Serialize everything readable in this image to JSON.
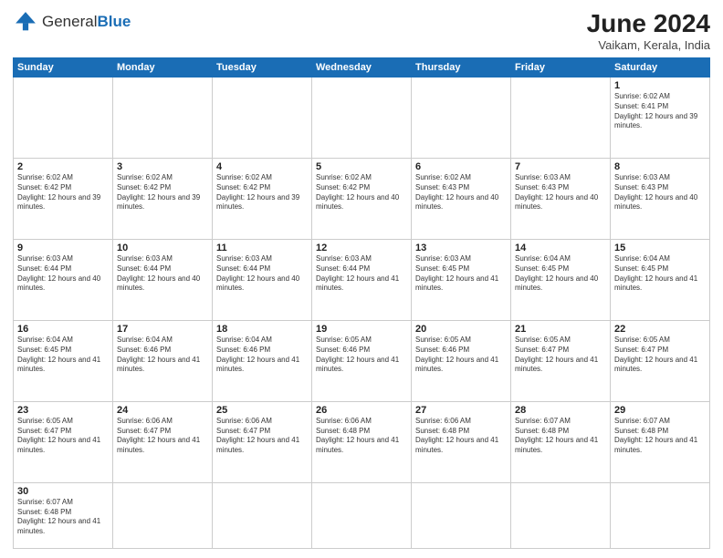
{
  "header": {
    "logo_general": "General",
    "logo_blue": "Blue",
    "title": "June 2024",
    "subtitle": "Vaikam, Kerala, India"
  },
  "weekdays": [
    "Sunday",
    "Monday",
    "Tuesday",
    "Wednesday",
    "Thursday",
    "Friday",
    "Saturday"
  ],
  "weeks": [
    [
      {
        "day": "",
        "sunrise": "",
        "sunset": "",
        "daylight": ""
      },
      {
        "day": "",
        "sunrise": "",
        "sunset": "",
        "daylight": ""
      },
      {
        "day": "",
        "sunrise": "",
        "sunset": "",
        "daylight": ""
      },
      {
        "day": "",
        "sunrise": "",
        "sunset": "",
        "daylight": ""
      },
      {
        "day": "",
        "sunrise": "",
        "sunset": "",
        "daylight": ""
      },
      {
        "day": "",
        "sunrise": "",
        "sunset": "",
        "daylight": ""
      },
      {
        "day": "1",
        "sunrise": "6:02 AM",
        "sunset": "6:41 PM",
        "daylight": "12 hours and 39 minutes."
      }
    ],
    [
      {
        "day": "2",
        "sunrise": "6:02 AM",
        "sunset": "6:42 PM",
        "daylight": "12 hours and 39 minutes."
      },
      {
        "day": "3",
        "sunrise": "6:02 AM",
        "sunset": "6:42 PM",
        "daylight": "12 hours and 39 minutes."
      },
      {
        "day": "4",
        "sunrise": "6:02 AM",
        "sunset": "6:42 PM",
        "daylight": "12 hours and 39 minutes."
      },
      {
        "day": "5",
        "sunrise": "6:02 AM",
        "sunset": "6:42 PM",
        "daylight": "12 hours and 40 minutes."
      },
      {
        "day": "6",
        "sunrise": "6:02 AM",
        "sunset": "6:43 PM",
        "daylight": "12 hours and 40 minutes."
      },
      {
        "day": "7",
        "sunrise": "6:03 AM",
        "sunset": "6:43 PM",
        "daylight": "12 hours and 40 minutes."
      },
      {
        "day": "8",
        "sunrise": "6:03 AM",
        "sunset": "6:43 PM",
        "daylight": "12 hours and 40 minutes."
      }
    ],
    [
      {
        "day": "9",
        "sunrise": "6:03 AM",
        "sunset": "6:44 PM",
        "daylight": "12 hours and 40 minutes."
      },
      {
        "day": "10",
        "sunrise": "6:03 AM",
        "sunset": "6:44 PM",
        "daylight": "12 hours and 40 minutes."
      },
      {
        "day": "11",
        "sunrise": "6:03 AM",
        "sunset": "6:44 PM",
        "daylight": "12 hours and 40 minutes."
      },
      {
        "day": "12",
        "sunrise": "6:03 AM",
        "sunset": "6:44 PM",
        "daylight": "12 hours and 41 minutes."
      },
      {
        "day": "13",
        "sunrise": "6:03 AM",
        "sunset": "6:45 PM",
        "daylight": "12 hours and 41 minutes."
      },
      {
        "day": "14",
        "sunrise": "6:04 AM",
        "sunset": "6:45 PM",
        "daylight": "12 hours and 40 minutes."
      },
      {
        "day": "15",
        "sunrise": "6:04 AM",
        "sunset": "6:45 PM",
        "daylight": "12 hours and 41 minutes."
      }
    ],
    [
      {
        "day": "16",
        "sunrise": "6:04 AM",
        "sunset": "6:45 PM",
        "daylight": "12 hours and 41 minutes."
      },
      {
        "day": "17",
        "sunrise": "6:04 AM",
        "sunset": "6:46 PM",
        "daylight": "12 hours and 41 minutes."
      },
      {
        "day": "18",
        "sunrise": "6:04 AM",
        "sunset": "6:46 PM",
        "daylight": "12 hours and 41 minutes."
      },
      {
        "day": "19",
        "sunrise": "6:05 AM",
        "sunset": "6:46 PM",
        "daylight": "12 hours and 41 minutes."
      },
      {
        "day": "20",
        "sunrise": "6:05 AM",
        "sunset": "6:46 PM",
        "daylight": "12 hours and 41 minutes."
      },
      {
        "day": "21",
        "sunrise": "6:05 AM",
        "sunset": "6:47 PM",
        "daylight": "12 hours and 41 minutes."
      },
      {
        "day": "22",
        "sunrise": "6:05 AM",
        "sunset": "6:47 PM",
        "daylight": "12 hours and 41 minutes."
      }
    ],
    [
      {
        "day": "23",
        "sunrise": "6:05 AM",
        "sunset": "6:47 PM",
        "daylight": "12 hours and 41 minutes."
      },
      {
        "day": "24",
        "sunrise": "6:06 AM",
        "sunset": "6:47 PM",
        "daylight": "12 hours and 41 minutes."
      },
      {
        "day": "25",
        "sunrise": "6:06 AM",
        "sunset": "6:47 PM",
        "daylight": "12 hours and 41 minutes."
      },
      {
        "day": "26",
        "sunrise": "6:06 AM",
        "sunset": "6:48 PM",
        "daylight": "12 hours and 41 minutes."
      },
      {
        "day": "27",
        "sunrise": "6:06 AM",
        "sunset": "6:48 PM",
        "daylight": "12 hours and 41 minutes."
      },
      {
        "day": "28",
        "sunrise": "6:07 AM",
        "sunset": "6:48 PM",
        "daylight": "12 hours and 41 minutes."
      },
      {
        "day": "29",
        "sunrise": "6:07 AM",
        "sunset": "6:48 PM",
        "daylight": "12 hours and 41 minutes."
      }
    ],
    [
      {
        "day": "30",
        "sunrise": "6:07 AM",
        "sunset": "6:48 PM",
        "daylight": "12 hours and 41 minutes."
      },
      {
        "day": "",
        "sunrise": "",
        "sunset": "",
        "daylight": ""
      },
      {
        "day": "",
        "sunrise": "",
        "sunset": "",
        "daylight": ""
      },
      {
        "day": "",
        "sunrise": "",
        "sunset": "",
        "daylight": ""
      },
      {
        "day": "",
        "sunrise": "",
        "sunset": "",
        "daylight": ""
      },
      {
        "day": "",
        "sunrise": "",
        "sunset": "",
        "daylight": ""
      },
      {
        "day": "",
        "sunrise": "",
        "sunset": "",
        "daylight": ""
      }
    ]
  ],
  "labels": {
    "sunrise": "Sunrise:",
    "sunset": "Sunset:",
    "daylight": "Daylight:"
  }
}
